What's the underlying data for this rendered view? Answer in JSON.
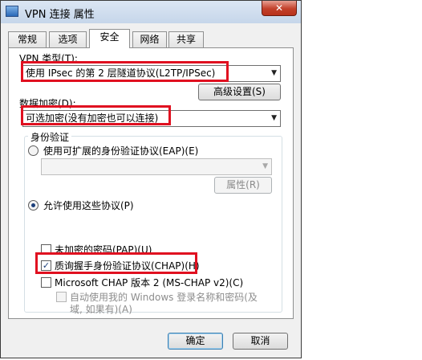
{
  "window": {
    "title": "VPN 连接 属性",
    "close_glyph": "✕"
  },
  "tabs": [
    "常规",
    "选项",
    "安全",
    "网络",
    "共享"
  ],
  "vpn_type": {
    "label": "VPN 类型(T):",
    "value": "使用 IPsec 的第 2 层隧道协议(L2TP/IPSec)"
  },
  "advanced_button": "高级设置(S)",
  "encryption": {
    "label": "数据加密(D):",
    "value": "可选加密(没有加密也可以连接)"
  },
  "auth": {
    "legend": "身份验证",
    "eap_option": "使用可扩展的身份验证协议(EAP)(E)",
    "properties_button": "属性(R)",
    "allow_option": "允许使用这些协议(P)",
    "pap": "未加密的密码(PAP)(U)",
    "chap": "质询握手身份验证协议(CHAP)(H)",
    "mschap": "Microsoft CHAP 版本 2 (MS-CHAP v2)(C)",
    "auto_logon_line1": "自动使用我的 Windows 登录名称和密码(及",
    "auto_logon_line2": "域, 如果有)(A)"
  },
  "checkmark": "✓",
  "dropdown_arrow": "▼",
  "buttons": {
    "ok": "确定",
    "cancel": "取消"
  },
  "colors": {
    "highlight": "#e01020",
    "close_button": "#c2402a"
  }
}
